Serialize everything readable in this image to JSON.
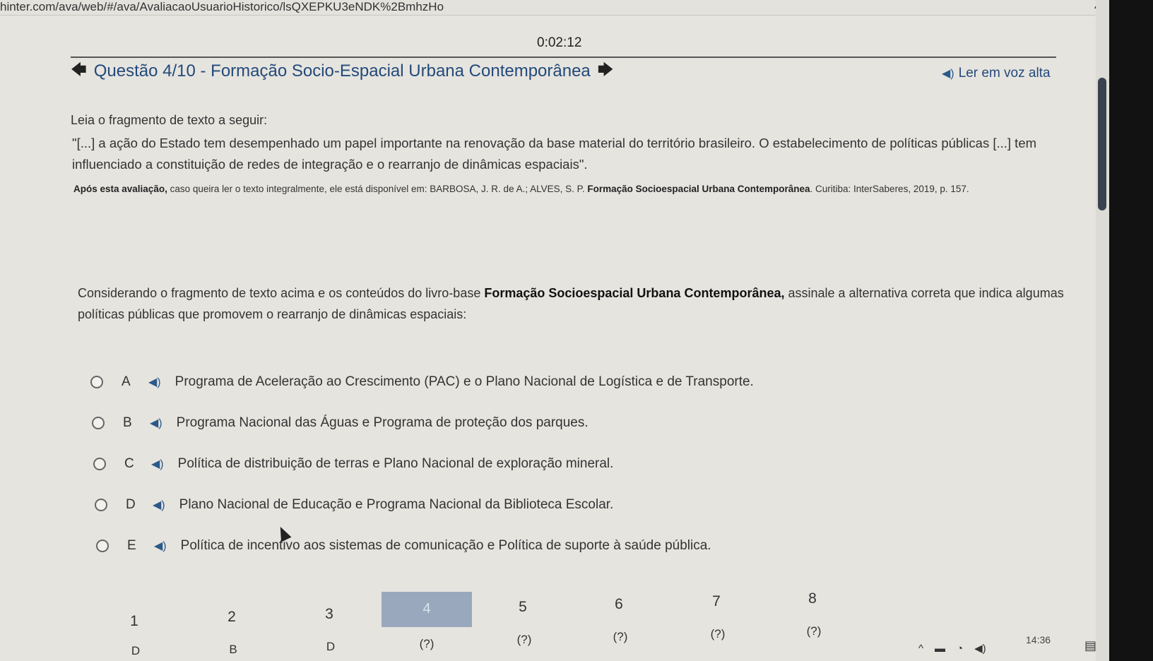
{
  "browser": {
    "url": "hinter.com/ava/web/#/ava/AvaliacaoUsuarioHistorico/lsQXEPKU3eNDK%2BmhzHo"
  },
  "timer": "0:02:12",
  "header": {
    "title": "Questão 4/10 - Formação Socio-Espacial Urbana Contemporânea",
    "read_aloud": "Ler em voz alta"
  },
  "body": {
    "intro": "Leia o fragmento de texto a seguir:",
    "quote": "\"[...] a ação do Estado tem desempenhado um papel importante na renovação da base material do território brasileiro. O estabelecimento de políticas públicas [...] tem influenciado a constituição de redes de integração e o rearranjo de dinâmicas espaciais\".",
    "source_bold1": "Após esta avaliação,",
    "source_text": " caso queira ler o texto integralmente, ele está disponível em: BARBOSA, J. R. de A.; ALVES, S. P. ",
    "source_bold2": "Formação Socioespacial Urbana Contemporânea",
    "source_tail": ". Curitiba: InterSaberes, 2019, p. 157.",
    "prompt_pre": "Considerando o fragmento de texto acima e os conteúdos do livro-base ",
    "prompt_bold": "Formação Socioespacial Urbana Contemporânea,",
    "prompt_post": " assinale a alternativa correta que indica algumas políticas públicas que promovem o rearranjo de dinâmicas espaciais:"
  },
  "options": [
    {
      "letter": "A",
      "text": "Programa de Aceleração ao Crescimento (PAC) e o Plano Nacional de Logística e de Transporte."
    },
    {
      "letter": "B",
      "text": "Programa Nacional das Águas e Programa de proteção dos parques."
    },
    {
      "letter": "C",
      "text": "Política de distribuição de terras e Plano Nacional de exploração mineral."
    },
    {
      "letter": "D",
      "text": "Plano Nacional de Educação e Programa Nacional da Biblioteca Escolar."
    },
    {
      "letter": "E",
      "text": "Política de incentivo aos sistemas de comunicação e Política de suporte à saúde pública."
    }
  ],
  "question_nav": [
    {
      "num": "1",
      "answer": "D"
    },
    {
      "num": "2",
      "answer": "B"
    },
    {
      "num": "3",
      "answer": "D"
    },
    {
      "num": "4",
      "answer": "(?)"
    },
    {
      "num": "5",
      "answer": "(?)"
    },
    {
      "num": "6",
      "answer": "(?)"
    },
    {
      "num": "7",
      "answer": "(?)"
    },
    {
      "num": "8",
      "answer": "(?)"
    }
  ],
  "taskbar": {
    "time": "14:36"
  },
  "icons": {
    "back": "arrow-left-icon",
    "forward": "arrow-right-icon",
    "speaker": "speaker-icon",
    "radio": "radio-icon"
  }
}
